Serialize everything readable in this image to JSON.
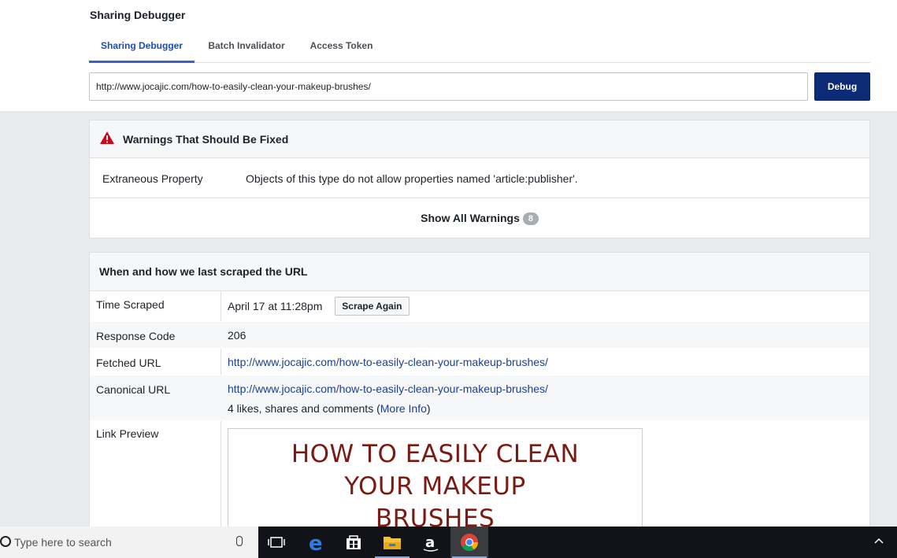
{
  "page": {
    "title": "Sharing Debugger"
  },
  "tabs": [
    {
      "label": "Sharing Debugger",
      "active": true
    },
    {
      "label": "Batch Invalidator",
      "active": false
    },
    {
      "label": "Access Token",
      "active": false
    }
  ],
  "url_input": {
    "value": "http://www.jocajic.com/how-to-easily-clean-your-makeup-brushes/"
  },
  "debug_button": "Debug",
  "warnings": {
    "title": "Warnings That Should Be Fixed",
    "rows": [
      {
        "key": "Extraneous Property",
        "value": "Objects of this type do not allow properties named 'article:publisher'."
      }
    ],
    "show_all_label": "Show All Warnings",
    "count": "8"
  },
  "scrape": {
    "title": "When and how we last scraped the URL",
    "time_scraped": {
      "label": "Time Scraped",
      "value": "April 17 at 11:28pm",
      "button": "Scrape Again"
    },
    "response_code": {
      "label": "Response Code",
      "value": "206"
    },
    "fetched_url": {
      "label": "Fetched URL",
      "value": "http://www.jocajic.com/how-to-easily-clean-your-makeup-brushes/"
    },
    "canonical_url": {
      "label": "Canonical URL",
      "value": "http://www.jocajic.com/how-to-easily-clean-your-makeup-brushes/",
      "stats_prefix": "4 likes, shares and comments (",
      "more_info": "More Info",
      "stats_suffix": ")"
    },
    "link_preview": {
      "label": "Link Preview",
      "image_text_lines": [
        "HOW TO EASILY CLEAN",
        "YOUR MAKEUP",
        "BRUSHES"
      ]
    }
  },
  "taskbar": {
    "search_placeholder": "Type here to search"
  },
  "colors": {
    "accent": "#0d2a77",
    "warning": "#d0021b",
    "tab_active": "#1e4db7",
    "preview_text": "#7a1a13"
  }
}
